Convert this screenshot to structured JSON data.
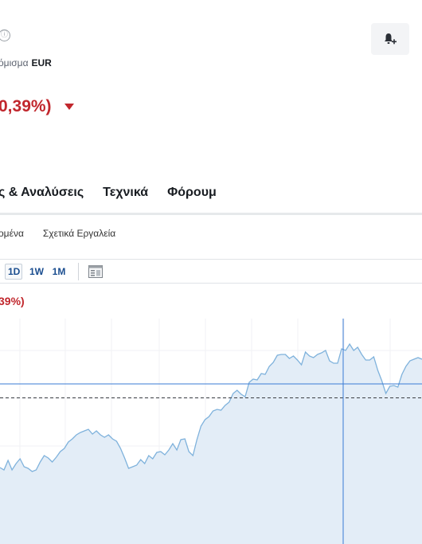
{
  "header": {
    "info_icon": "ⓘ",
    "currency_label": "όμισμα",
    "currency_code": "EUR",
    "change_pct": "0,39%)",
    "alert_icon": "bell-plus-icon"
  },
  "main_tabs": [
    "ς & Αναλύσεις",
    "Τεχνικά",
    "Φόρουμ"
  ],
  "sub_tabs": [
    "ομένα",
    "Σχετικά Εργαλεία"
  ],
  "toolbar": {
    "ranges": [
      "1D",
      "1W",
      "1M"
    ],
    "active_range": "1D",
    "chart_type_icon": "chart-type-icon"
  },
  "chart_data": {
    "type": "area",
    "change_label": "39%)",
    "color": "#7fb2dc",
    "fill": "#e3edf7",
    "y": [
      587,
      590,
      578,
      590,
      582,
      576,
      586,
      588,
      592,
      590,
      580,
      572,
      575,
      580,
      574,
      567,
      563,
      555,
      551,
      546,
      543,
      541,
      539,
      545,
      541,
      546,
      549,
      546,
      551,
      554,
      563,
      575,
      588,
      586,
      584,
      577,
      582,
      572,
      576,
      568,
      567,
      571,
      565,
      557,
      565,
      552,
      551,
      567,
      572,
      552,
      535,
      527,
      523,
      516,
      514,
      515,
      509,
      505,
      494,
      490,
      495,
      498,
      480,
      476,
      477,
      469,
      470,
      460,
      455,
      446,
      445,
      445,
      450,
      447,
      452,
      458,
      442,
      447,
      449,
      445,
      443,
      440,
      453,
      456,
      456,
      438,
      440,
      432,
      440,
      436,
      445,
      452,
      452,
      448,
      465,
      478,
      494,
      485,
      484,
      486,
      470,
      460,
      453,
      451,
      449,
      451
    ]
  }
}
